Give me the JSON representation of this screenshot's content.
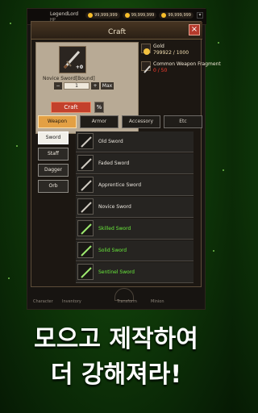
{
  "top_bar": {
    "player_name": "LegendLord",
    "hp_label": "HP",
    "currency": [
      {
        "value": "99,999,999",
        "icon": "gold-coin-icon"
      },
      {
        "value": "99,999,999",
        "icon": "gold-coin-icon"
      },
      {
        "value": "99,999,999",
        "icon": "gold-coin-icon"
      }
    ],
    "menu_icon": "menu-icon"
  },
  "craft": {
    "title": "Craft",
    "close_icon": "×",
    "selected_item": {
      "name": "Novice Sword[Bound]",
      "count": "+0",
      "quantity": "1",
      "minus": "−",
      "plus": "+",
      "max_label": "Max",
      "craft_button": "Craft",
      "percent_button": "%"
    },
    "materials": [
      {
        "name": "Gold",
        "value": "799922 / 1000",
        "value_color": "#f6e2b3",
        "icon": "gold-coin-icon"
      },
      {
        "name": "Common Weapon Fragment",
        "value": "0 / 50",
        "value_color": "#ff3d2f",
        "icon": "fragment-icon"
      }
    ],
    "categories": [
      {
        "label": "Weapon",
        "active": true
      },
      {
        "label": "Armor",
        "active": false
      },
      {
        "label": "Accessory",
        "active": false
      },
      {
        "label": "Etc",
        "active": false
      }
    ],
    "weapon_types": [
      {
        "label": "Sword",
        "active": true
      },
      {
        "label": "Staff",
        "active": false
      },
      {
        "label": "Dagger",
        "active": false
      },
      {
        "label": "Orb",
        "active": false
      }
    ],
    "items": [
      {
        "name": "Old Sword",
        "rarity": "common"
      },
      {
        "name": "Faded Sword",
        "rarity": "common"
      },
      {
        "name": "Apprentice Sword",
        "rarity": "common"
      },
      {
        "name": "Novice Sword",
        "rarity": "common"
      },
      {
        "name": "Skilled Sword",
        "rarity": "uncommon"
      },
      {
        "name": "Solid Sword",
        "rarity": "uncommon"
      },
      {
        "name": "Sentinel Sword",
        "rarity": "uncommon"
      }
    ]
  },
  "bottom_nav": {
    "items": [
      "Character",
      "Inventory",
      "Transform",
      "Minion"
    ]
  },
  "promo": {
    "line1": "모으고 제작하여",
    "line2": "더 강해져라!"
  }
}
